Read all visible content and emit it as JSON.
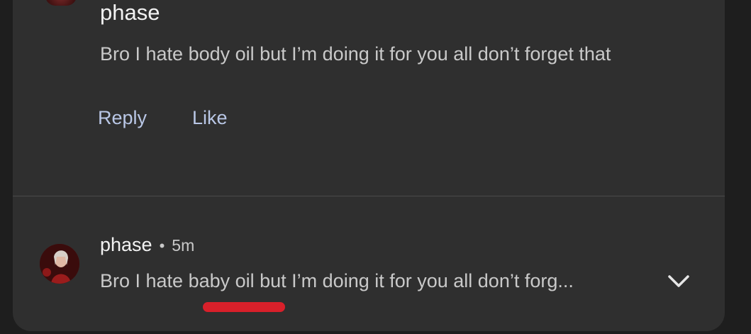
{
  "expanded_comment": {
    "author": "phase",
    "text": "Bro I hate body oil but I’m doing it for you all don’t forget that",
    "actions": {
      "reply_label": "Reply",
      "like_label": "Like"
    }
  },
  "collapsed_comment": {
    "author": "phase",
    "separator": "•",
    "time": "5m",
    "text": "Bro I hate baby oil but I’m doing it for you all don’t forg..."
  },
  "icons": {
    "expand": "chevron-down-icon"
  },
  "colors": {
    "background": "#1e1e1e",
    "card": "#2f2f2f",
    "action_text": "#b9c7e6",
    "highlight_mark": "#d8202a"
  }
}
